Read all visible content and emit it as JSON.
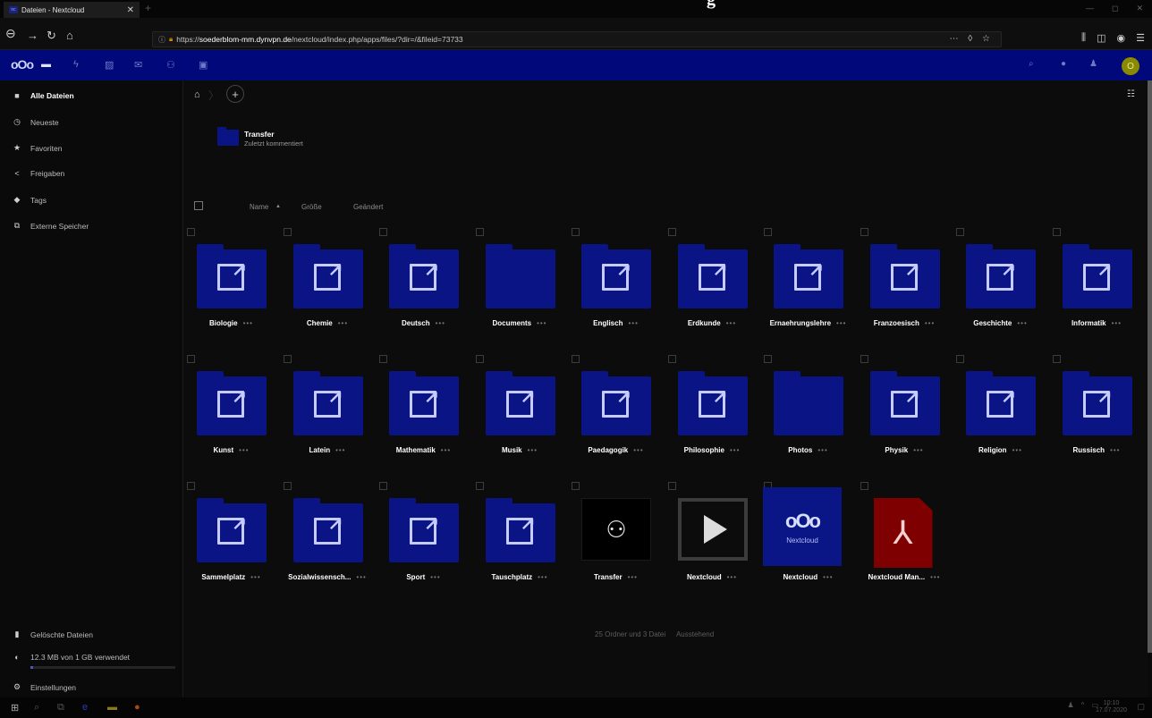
{
  "browser": {
    "tab_title": "Dateien - Nextcloud",
    "tab_favicon": "nc",
    "url_scheme": "https://",
    "url_host": "soederblom-mm.dynvpn.de",
    "url_path": "/nextcloud/index.php/apps/files/?dir=/&fileid=73733",
    "page_heading_sliver": "g"
  },
  "nextcloud": {
    "logo": "oOo",
    "avatar_initial": "O",
    "brand_color": "#00087a",
    "apps": [
      "files-icon",
      "activity-icon",
      "gallery-icon",
      "mail-icon",
      "contacts-icon",
      "calendar-icon"
    ]
  },
  "sidebar": {
    "items": [
      {
        "label": "Alle Dateien",
        "icon": "folder-icon"
      },
      {
        "label": "Neueste",
        "icon": "clock-icon"
      },
      {
        "label": "Favoriten",
        "icon": "star-icon"
      },
      {
        "label": "Freigaben",
        "icon": "share-icon"
      },
      {
        "label": "Tags",
        "icon": "tag-icon"
      },
      {
        "label": "Externe Speicher",
        "icon": "external-storage-icon"
      }
    ],
    "bottom": {
      "deleted": "Gelöschte Dateien",
      "quota": "12.3 MB von 1 GB verwendet",
      "quota_fraction": 0.012,
      "settings": "Einstellungen"
    }
  },
  "main": {
    "recent": {
      "name": "Transfer",
      "subtitle": "Zuletzt kommentiert"
    },
    "columns": {
      "name": "Name",
      "sort_indicator": "▲",
      "size": "Größe",
      "modified": "Geändert"
    },
    "files": [
      {
        "name": "Biologie",
        "kind": "shared-folder"
      },
      {
        "name": "Chemie",
        "kind": "shared-folder"
      },
      {
        "name": "Deutsch",
        "kind": "shared-folder"
      },
      {
        "name": "Documents",
        "kind": "folder"
      },
      {
        "name": "Englisch",
        "kind": "shared-folder"
      },
      {
        "name": "Erdkunde",
        "kind": "shared-folder"
      },
      {
        "name": "Ernaehrungslehre",
        "kind": "shared-folder"
      },
      {
        "name": "Franzoesisch",
        "kind": "shared-folder"
      },
      {
        "name": "Geschichte",
        "kind": "shared-folder"
      },
      {
        "name": "Informatik",
        "kind": "shared-folder"
      },
      {
        "name": "Kunst",
        "kind": "shared-folder"
      },
      {
        "name": "Latein",
        "kind": "shared-folder"
      },
      {
        "name": "Mathematik",
        "kind": "shared-folder"
      },
      {
        "name": "Musik",
        "kind": "shared-folder"
      },
      {
        "name": "Paedagogik",
        "kind": "shared-folder"
      },
      {
        "name": "Philosophie",
        "kind": "shared-folder"
      },
      {
        "name": "Photos",
        "kind": "folder"
      },
      {
        "name": "Physik",
        "kind": "shared-folder"
      },
      {
        "name": "Religion",
        "kind": "shared-folder"
      },
      {
        "name": "Russisch",
        "kind": "shared-folder"
      },
      {
        "name": "Sammelplatz",
        "kind": "shared-folder"
      },
      {
        "name": "Sozialwissensch...",
        "kind": "shared-folder"
      },
      {
        "name": "Sport",
        "kind": "shared-folder"
      },
      {
        "name": "Tauschplatz",
        "kind": "shared-folder"
      },
      {
        "name": "Transfer",
        "kind": "contact"
      },
      {
        "name": "Nextcloud",
        "kind": "video"
      },
      {
        "name": "Nextcloud",
        "kind": "nextcloud-image"
      },
      {
        "name": "Nextcloud Man...",
        "kind": "pdf"
      }
    ],
    "more_label": "•••",
    "summary_count": "25 Ordner und 3 Datei",
    "summary_status": "Ausstehend"
  },
  "taskbar": {
    "clock_time": "10:10",
    "clock_date": "17.07.2020"
  }
}
